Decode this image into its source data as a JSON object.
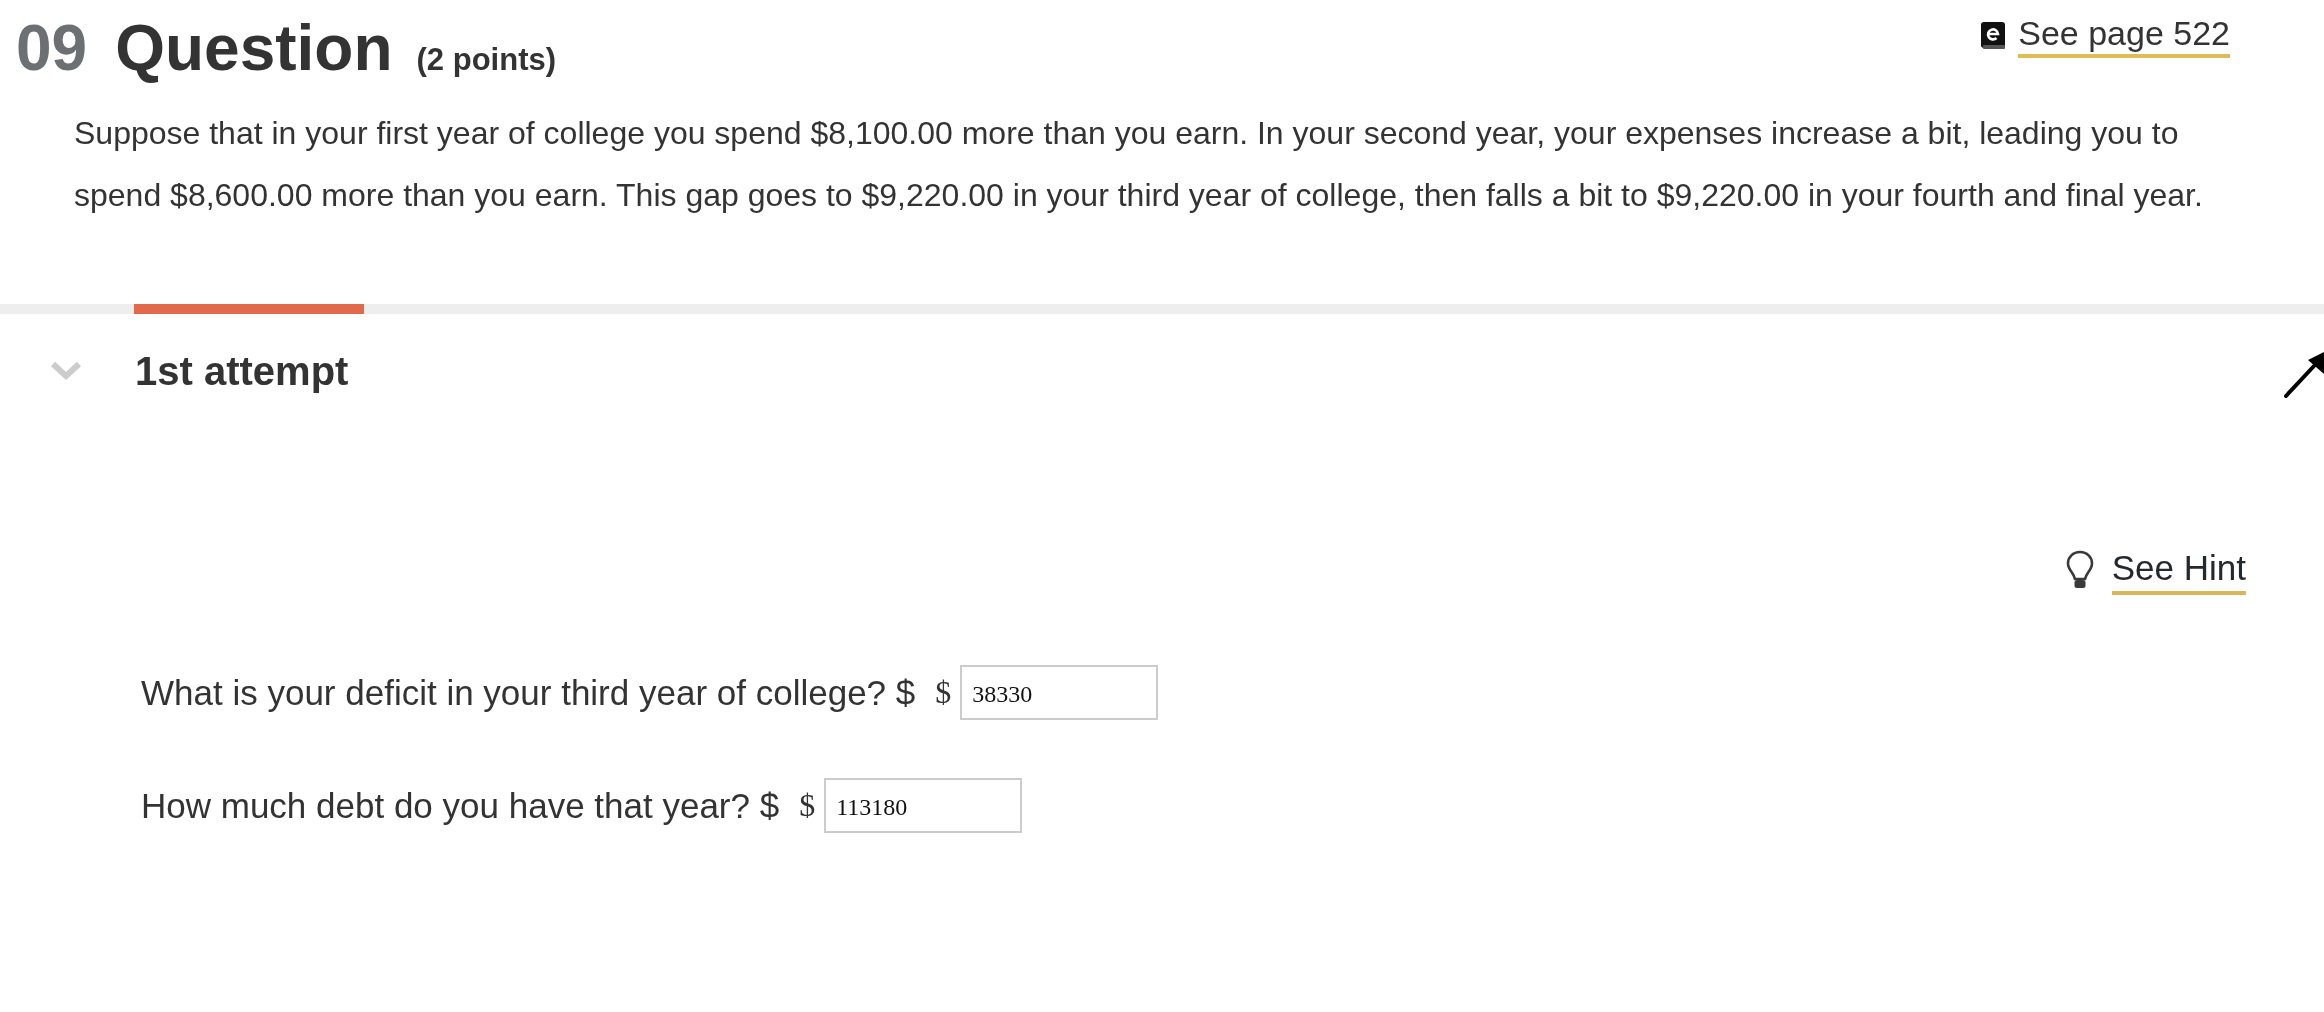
{
  "question": {
    "number": "09",
    "title": "Question",
    "points": "(2 points)",
    "ebook_link": "See page 522",
    "text": "Suppose that in your first year of college you spend $8,100.00 more than you earn. In your second year, your expenses increase a bit, leading you to spend $8,600.00 more than you earn. This gap goes to $9,220.00 in your third year of college, then falls a bit to $9,220.00 in your fourth and final year."
  },
  "attempt": {
    "label": "1st attempt",
    "selected": true,
    "expanded": true
  },
  "hint": {
    "label": "See Hint"
  },
  "answers": [
    {
      "prompt": "What is your deficit in your third year of college? $",
      "unit": "$",
      "value": "38330"
    },
    {
      "prompt": "How much debt do you have that year? $",
      "unit": "$",
      "value": "113180"
    }
  ]
}
